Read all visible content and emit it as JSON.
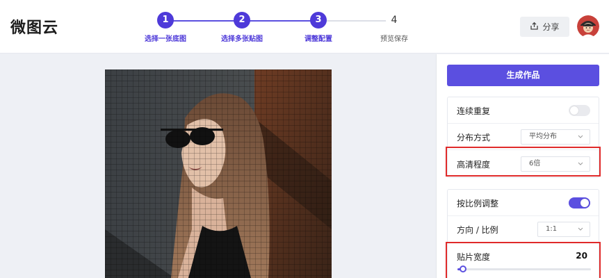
{
  "app": {
    "logo": "微图云"
  },
  "steps": [
    {
      "number": "1",
      "label": "选择一张底图",
      "state": "done"
    },
    {
      "number": "2",
      "label": "选择多张贴图",
      "state": "done"
    },
    {
      "number": "3",
      "label": "调整配置",
      "state": "active"
    },
    {
      "number": "4",
      "label": "预览保存",
      "state": "pending"
    }
  ],
  "header": {
    "share_label": "分享"
  },
  "panel": {
    "generate_label": "生成作品",
    "repeat": {
      "label": "连续重复",
      "enabled": false
    },
    "distribution": {
      "label": "分布方式",
      "value": "平均分布"
    },
    "clarity": {
      "label": "高清程度",
      "value": "6倍"
    },
    "ratio_adjust": {
      "label": "按比例调整",
      "enabled": true
    },
    "direction": {
      "label": "方向 / 比例",
      "value": "1:1"
    },
    "tile_width": {
      "label": "贴片宽度",
      "value": "20"
    }
  },
  "colors": {
    "accent": "#5b4fe0",
    "highlight": "#e02a2a"
  }
}
